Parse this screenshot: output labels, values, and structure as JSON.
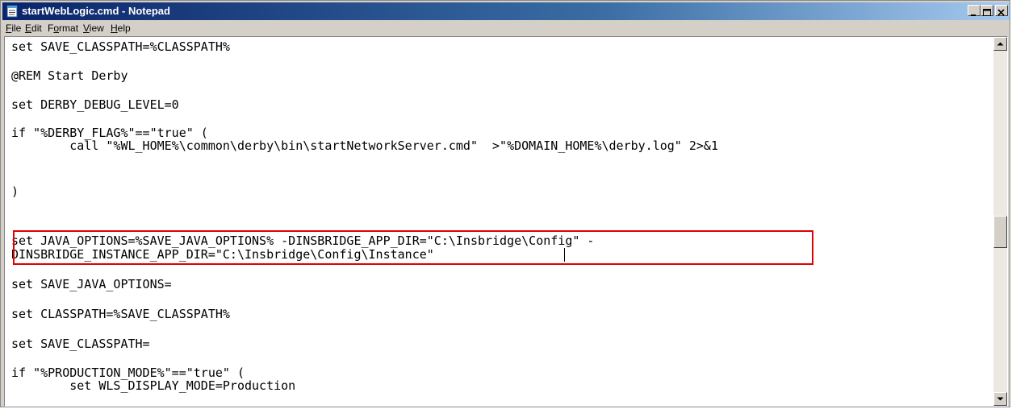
{
  "window": {
    "title": "startWebLogic.cmd - Notepad"
  },
  "menu": [
    {
      "label_pre": "",
      "label_ul": "F",
      "label_post": "ile"
    },
    {
      "label_pre": "",
      "label_ul": "E",
      "label_post": "dit"
    },
    {
      "label_pre": "F",
      "label_ul": "o",
      "label_post": "rmat"
    },
    {
      "label_pre": "",
      "label_ul": "V",
      "label_post": "iew"
    },
    {
      "label_pre": "",
      "label_ul": "H",
      "label_post": "elp"
    }
  ],
  "document": {
    "lines": [
      "set SAVE_CLASSPATH=%CLASSPATH%",
      "",
      "@REM Start Derby",
      "",
      "set DERBY_DEBUG_LEVEL=0",
      "",
      "if \"%DERBY_FLAG%\"==\"true\" (",
      "        call \"%WL_HOME%\\common\\derby\\bin\\startNetworkServer.cmd\"  >\"%DOMAIN_HOME%\\derby.log\" 2>&1",
      "",
      ")",
      "",
      "set JAVA_OPTIONS=%SAVE_JAVA_OPTIONS% -DINSBRIDGE_APP_DIR=\"C:\\Insbridge\\Config\" -",
      "DINSBRIDGE_INSTANCE_APP_DIR=\"C:\\Insbridge\\Config\\Instance\"",
      "",
      "set SAVE_JAVA_OPTIONS=",
      "",
      "set CLASSPATH=%SAVE_CLASSPATH%",
      "",
      "set SAVE_CLASSPATH=",
      "",
      "if \"%PRODUCTION_MODE%\"==\"true\" (",
      "        set WLS_DISPLAY_MODE=Production"
    ]
  },
  "colors": {
    "highlight_border": "#e00000",
    "titlebar_start": "#0a246a",
    "titlebar_end": "#a6caf0"
  },
  "icons": [
    "notepad-icon",
    "minimize-icon",
    "maximize-icon",
    "close-icon",
    "scroll-up-arrow-icon",
    "scroll-down-arrow-icon"
  ]
}
